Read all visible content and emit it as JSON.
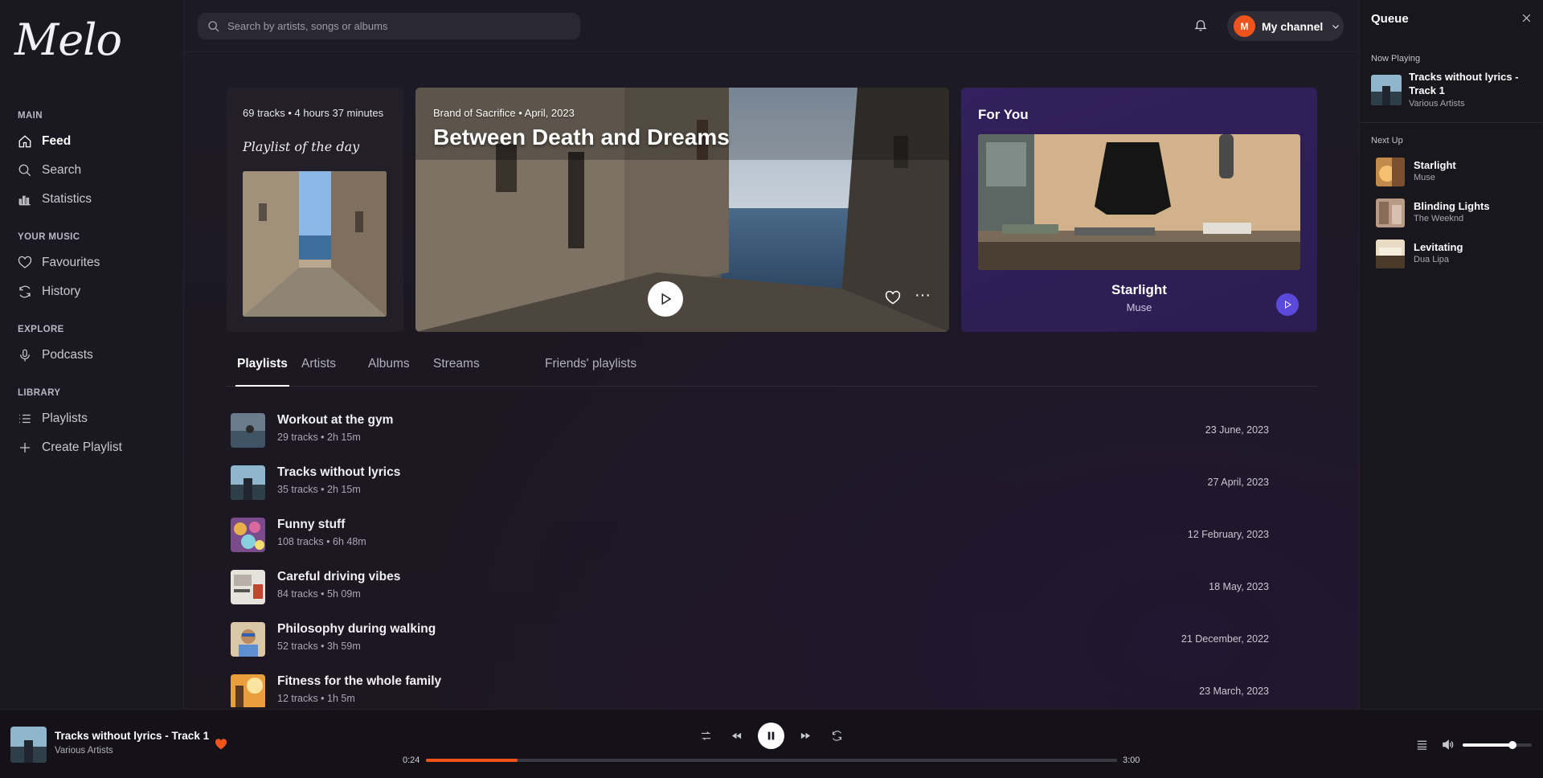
{
  "app": {
    "logo": "Melo"
  },
  "sidebar": {
    "sections": [
      {
        "title": "MAIN",
        "items": [
          {
            "label": "Feed",
            "icon": "home-icon",
            "active": true
          },
          {
            "label": "Search",
            "icon": "search-icon"
          },
          {
            "label": "Statistics",
            "icon": "bar-chart-icon"
          }
        ]
      },
      {
        "title": "YOUR MUSIC",
        "items": [
          {
            "label": "Favourites",
            "icon": "heart-icon"
          },
          {
            "label": "History",
            "icon": "refresh-icon"
          }
        ]
      },
      {
        "title": "EXPLORE",
        "items": [
          {
            "label": "Podcasts",
            "icon": "microphone-icon"
          }
        ]
      },
      {
        "title": "LIBRARY",
        "items": [
          {
            "label": "Playlists",
            "icon": "list-icon"
          },
          {
            "label": "Create Playlist",
            "icon": "plus-icon"
          }
        ]
      }
    ]
  },
  "header": {
    "search_placeholder": "Search by artists, songs or albums",
    "channel": {
      "avatar_letter": "M",
      "label": "My channel",
      "avatar_color": "#f0541c"
    }
  },
  "playlist_of_day": {
    "meta": "69 tracks • 4 hours 37 minutes",
    "label": "Playlist of the day"
  },
  "hero": {
    "subtitle": "Brand of Sacrifice • April, 2023",
    "title": "Between Death and Dreams"
  },
  "for_you": {
    "label": "For You",
    "song": "Starlight",
    "artist": "Muse",
    "accent": "#5b49dc"
  },
  "tabs": [
    "Playlists",
    "Artists",
    "Albums",
    "Streams",
    "Friends' playlists"
  ],
  "playlists": [
    {
      "name": "Workout at the gym",
      "meta": "29 tracks • 2h 15m",
      "date": "23 June, 2023"
    },
    {
      "name": "Tracks without lyrics",
      "meta": "35 tracks • 2h 15m",
      "date": "27 April, 2023"
    },
    {
      "name": "Funny stuff",
      "meta": "108 tracks • 6h 48m",
      "date": "12 February, 2023"
    },
    {
      "name": "Careful driving vibes",
      "meta": "84 tracks • 5h 09m",
      "date": "18 May, 2023"
    },
    {
      "name": "Philosophy during walking",
      "meta": "52 tracks • 3h 59m",
      "date": "21 December, 2022"
    },
    {
      "name": "Fitness for the whole family",
      "meta": "12 tracks • 1h 5m",
      "date": "23 March, 2023"
    }
  ],
  "queue": {
    "title": "Queue",
    "now_playing_label": "Now Playing",
    "now_playing": {
      "title": "Tracks without lyrics - Track 1",
      "artist": "Various Artists"
    },
    "next_up_label": "Next Up",
    "next_up": [
      {
        "title": "Starlight",
        "artist": "Muse"
      },
      {
        "title": "Blinding Lights",
        "artist": "The Weeknd"
      },
      {
        "title": "Levitating",
        "artist": "Dua Lipa"
      }
    ]
  },
  "player": {
    "title": "Tracks without lyrics - Track 1",
    "artist": "Various Artists",
    "current_time": "0:24",
    "duration": "3:00",
    "progress_percent": 13.3,
    "volume_percent": 72,
    "accent": "#f0541c"
  }
}
